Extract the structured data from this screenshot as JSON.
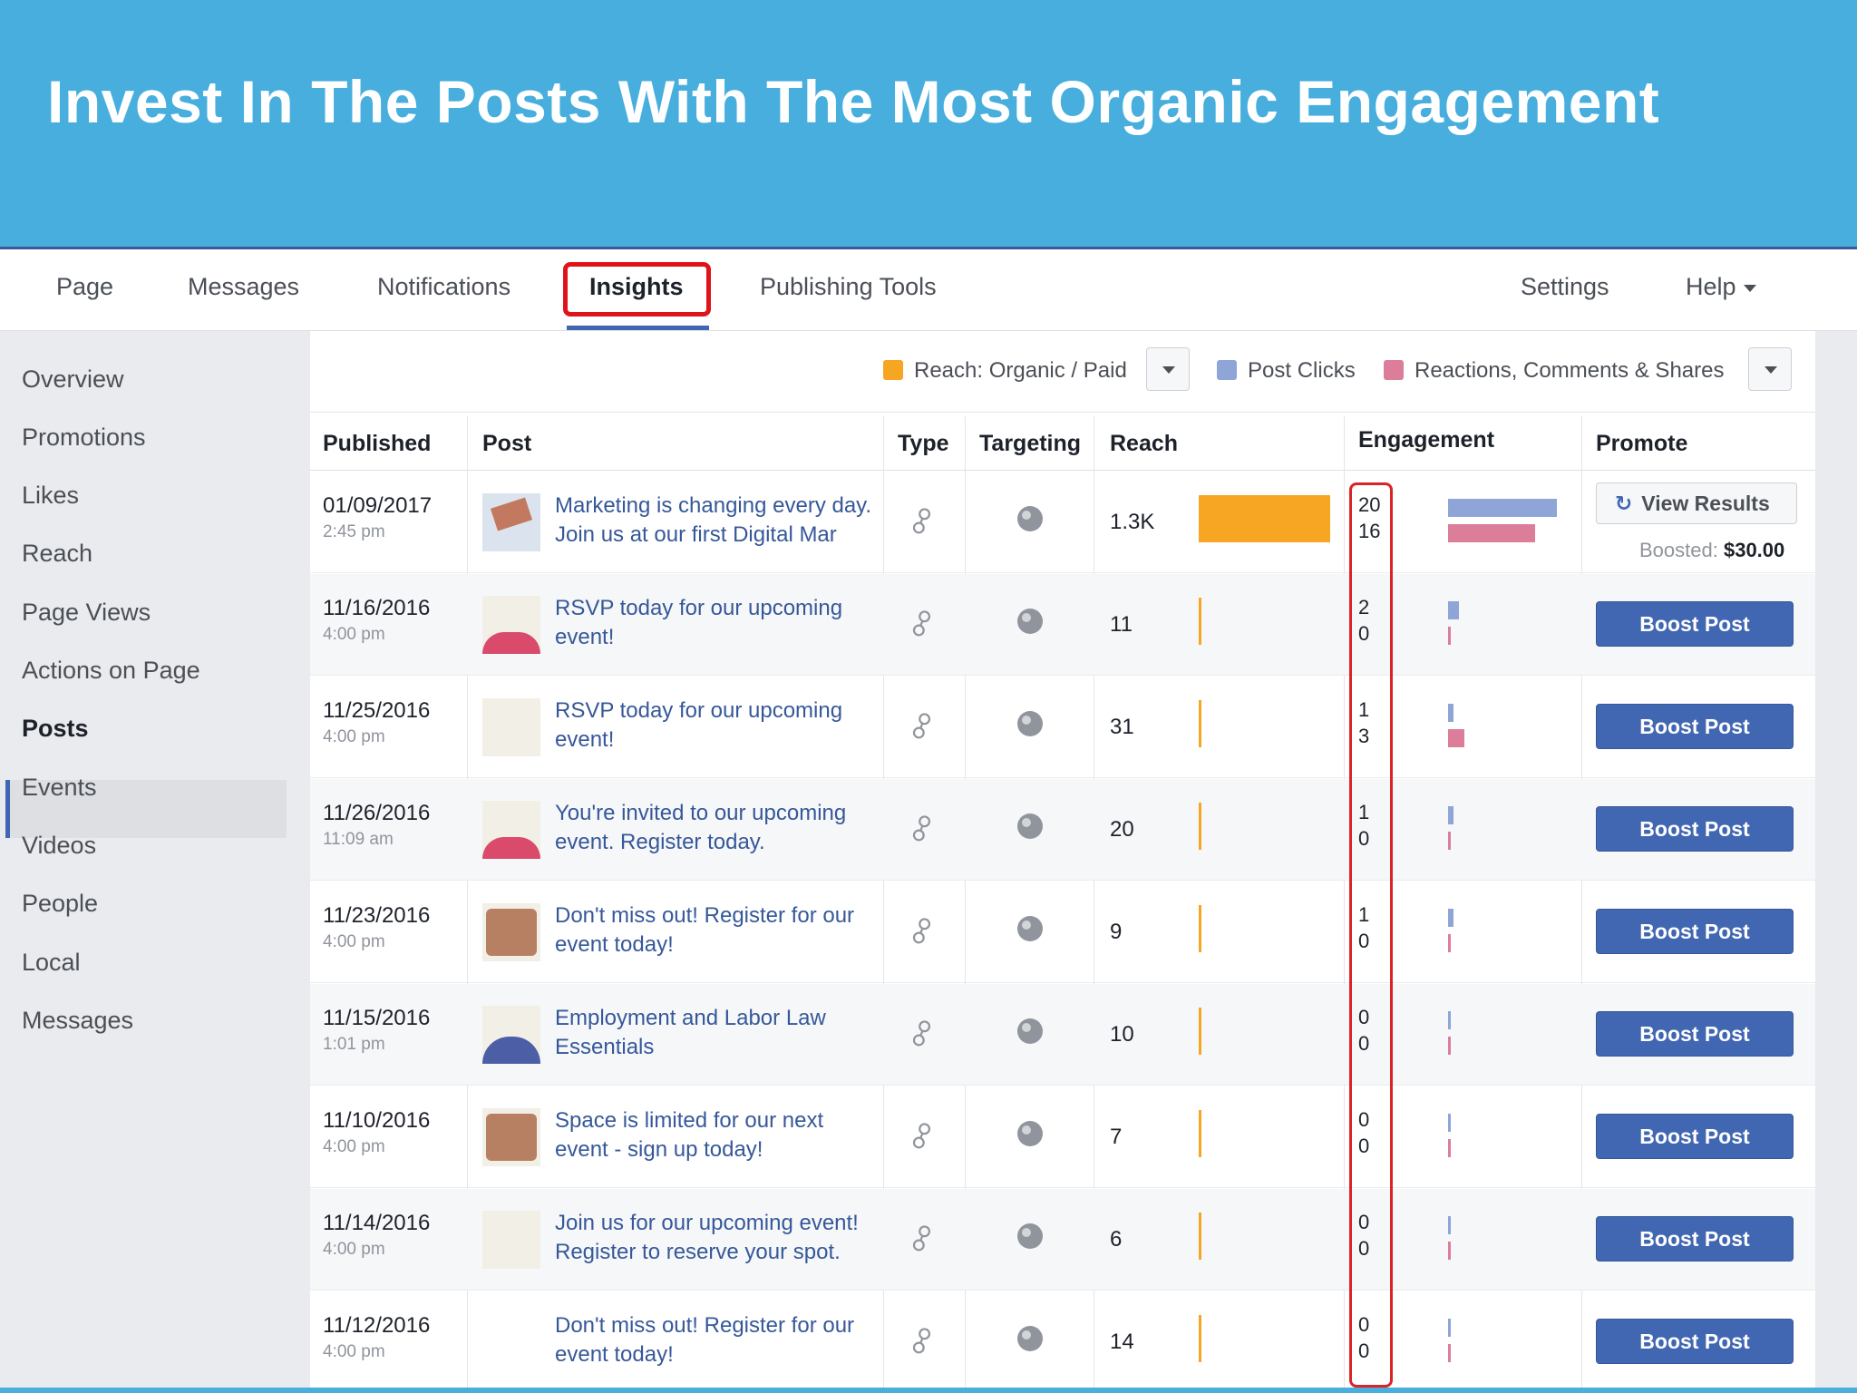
{
  "slide": {
    "title": "Invest In The Posts With The Most Organic Engagement"
  },
  "nav": {
    "tabs": [
      {
        "label": "Page"
      },
      {
        "label": "Messages"
      },
      {
        "label": "Notifications"
      },
      {
        "label": "Insights"
      },
      {
        "label": "Publishing Tools"
      }
    ],
    "settings": "Settings",
    "help": "Help"
  },
  "sidebar": {
    "items": [
      {
        "label": "Overview"
      },
      {
        "label": "Promotions"
      },
      {
        "label": "Likes"
      },
      {
        "label": "Reach"
      },
      {
        "label": "Page Views"
      },
      {
        "label": "Actions on Page"
      },
      {
        "label": "Posts"
      },
      {
        "label": "Events"
      },
      {
        "label": "Videos"
      },
      {
        "label": "People"
      },
      {
        "label": "Local"
      },
      {
        "label": "Messages"
      }
    ],
    "active": "Posts"
  },
  "legend": {
    "reach": "Reach: Organic / Paid",
    "clicks": "Post Clicks",
    "reactions": "Reactions, Comments & Shares",
    "colors": {
      "reach": "#f6a623",
      "clicks": "#8fa5d8",
      "reactions": "#dc7d9a"
    }
  },
  "table": {
    "headers": {
      "published": "Published",
      "post": "Post",
      "type": "Type",
      "targeting": "Targeting",
      "reach": "Reach",
      "engagement": "Engagement",
      "promote": "Promote"
    },
    "rows": [
      {
        "date": "01/09/2017",
        "time": "2:45 pm",
        "post": "Marketing is changing every day. Join us at our first Digital Mar",
        "reach": "1.3K",
        "reach_value": 1300,
        "clicks": "20",
        "reactions": "16",
        "promote": "View Results",
        "boosted_label": "Boosted:",
        "boosted_amount": "$30.00"
      },
      {
        "date": "11/16/2016",
        "time": "4:00 pm",
        "post": "RSVP today for our upcoming event!",
        "reach": "11",
        "reach_value": 11,
        "clicks": "2",
        "reactions": "0",
        "promote": "Boost Post"
      },
      {
        "date": "11/25/2016",
        "time": "4:00 pm",
        "post": "RSVP today for our upcoming event!",
        "reach": "31",
        "reach_value": 31,
        "clicks": "1",
        "reactions": "3",
        "promote": "Boost Post"
      },
      {
        "date": "11/26/2016",
        "time": "11:09 am",
        "post": "You're invited to our upcoming event. Register today.",
        "reach": "20",
        "reach_value": 20,
        "clicks": "1",
        "reactions": "0",
        "promote": "Boost Post"
      },
      {
        "date": "11/23/2016",
        "time": "4:00 pm",
        "post": "Don't miss out! Register for our event today!",
        "reach": "9",
        "reach_value": 9,
        "clicks": "1",
        "reactions": "0",
        "promote": "Boost Post"
      },
      {
        "date": "11/15/2016",
        "time": "1:01 pm",
        "post": "Employment and Labor Law Essentials",
        "reach": "10",
        "reach_value": 10,
        "clicks": "0",
        "reactions": "0",
        "promote": "Boost Post"
      },
      {
        "date": "11/10/2016",
        "time": "4:00 pm",
        "post": "Space is limited for our next event - sign up today!",
        "reach": "7",
        "reach_value": 7,
        "clicks": "0",
        "reactions": "0",
        "promote": "Boost Post"
      },
      {
        "date": "11/14/2016",
        "time": "4:00 pm",
        "post": "Join us for our upcoming event! Register to reserve your spot.",
        "reach": "6",
        "reach_value": 6,
        "clicks": "0",
        "reactions": "0",
        "promote": "Boost Post"
      },
      {
        "date": "11/12/2016",
        "time": "4:00 pm",
        "post": "Don't miss out! Register for our event today!",
        "reach": "14",
        "reach_value": 14,
        "clicks": "0",
        "reactions": "0",
        "promote": "Boost Post"
      }
    ]
  }
}
